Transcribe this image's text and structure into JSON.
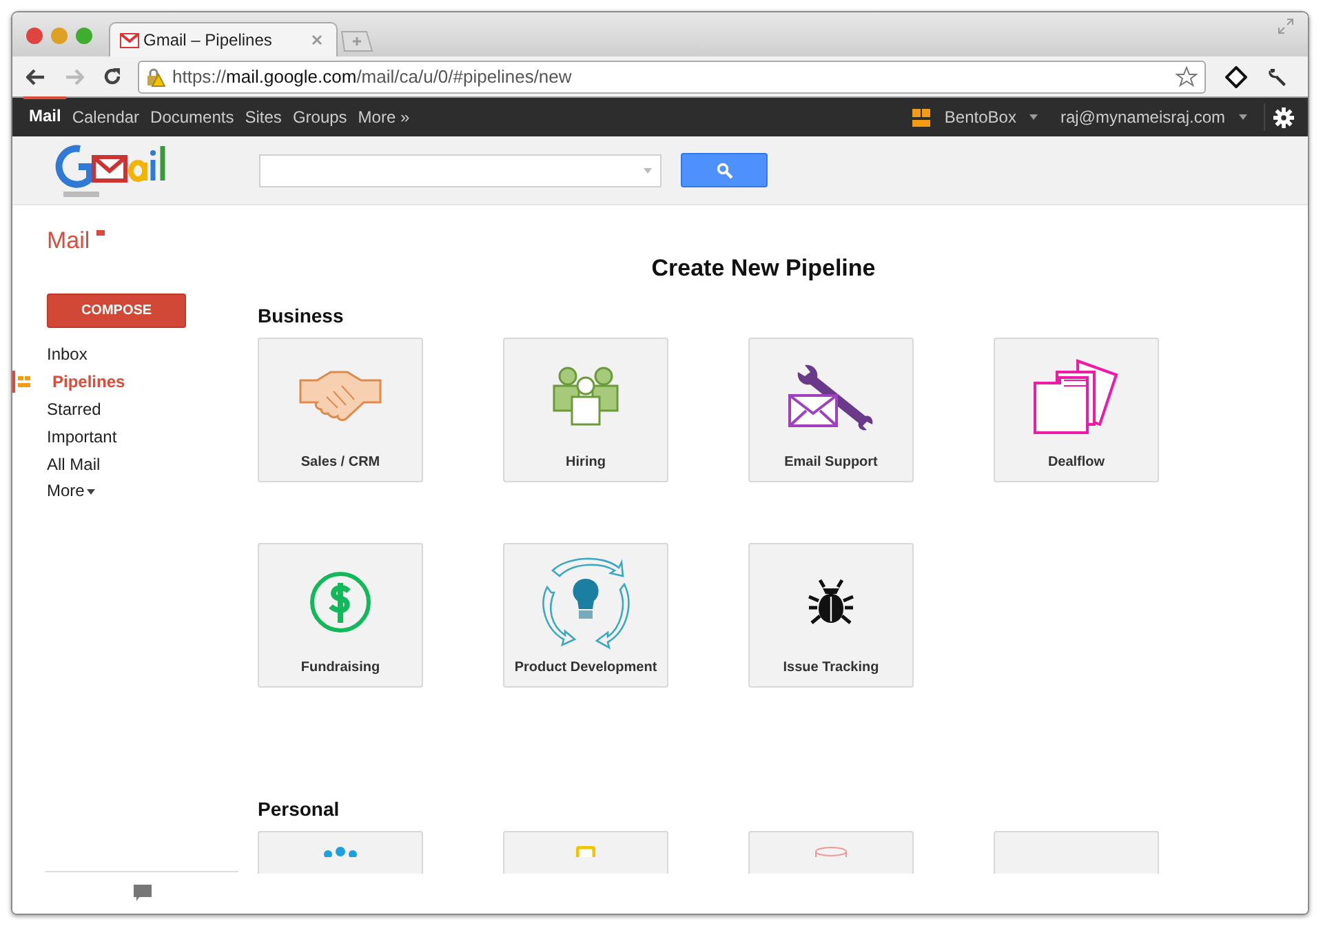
{
  "browser": {
    "tab": {
      "title": "Gmail – Pipelines"
    },
    "url": {
      "scheme": "https://",
      "host": "mail.google.com",
      "path": "/mail/ca/u/0/#pipelines/new"
    }
  },
  "google_bar": {
    "items": [
      {
        "label": "Mail",
        "selected": true
      },
      {
        "label": "Calendar",
        "selected": false
      },
      {
        "label": "Documents",
        "selected": false
      },
      {
        "label": "Sites",
        "selected": false
      },
      {
        "label": "Groups",
        "selected": false
      },
      {
        "label": "More »",
        "selected": false
      }
    ],
    "extension": "BentoBox",
    "account": "raj@mynameisraj.com"
  },
  "sidebar": {
    "title": "Mail",
    "compose": "COMPOSE",
    "items": [
      {
        "label": "Inbox",
        "selected": false
      },
      {
        "label": "Pipelines",
        "selected": true
      },
      {
        "label": "Starred",
        "selected": false
      },
      {
        "label": "Important",
        "selected": false
      },
      {
        "label": "All Mail",
        "selected": false
      }
    ],
    "more": "More"
  },
  "page": {
    "title": "Create New Pipeline",
    "sections": [
      {
        "heading": "Business",
        "tiles": [
          {
            "label": "Sales / CRM",
            "kind": "handshake"
          },
          {
            "label": "Hiring",
            "kind": "people"
          },
          {
            "label": "Email Support",
            "kind": "envelope-wrench"
          },
          {
            "label": "Dealflow",
            "kind": "folder"
          },
          {
            "label": "Fundraising",
            "kind": "dollar"
          },
          {
            "label": "Product Development",
            "kind": "bulb"
          },
          {
            "label": "Issue Tracking",
            "kind": "bug"
          }
        ]
      },
      {
        "heading": "Personal",
        "tiles": [
          {
            "kind": "dots"
          },
          {
            "kind": "square"
          },
          {
            "kind": "cylinder"
          },
          {
            "kind": "blank"
          }
        ]
      }
    ]
  }
}
